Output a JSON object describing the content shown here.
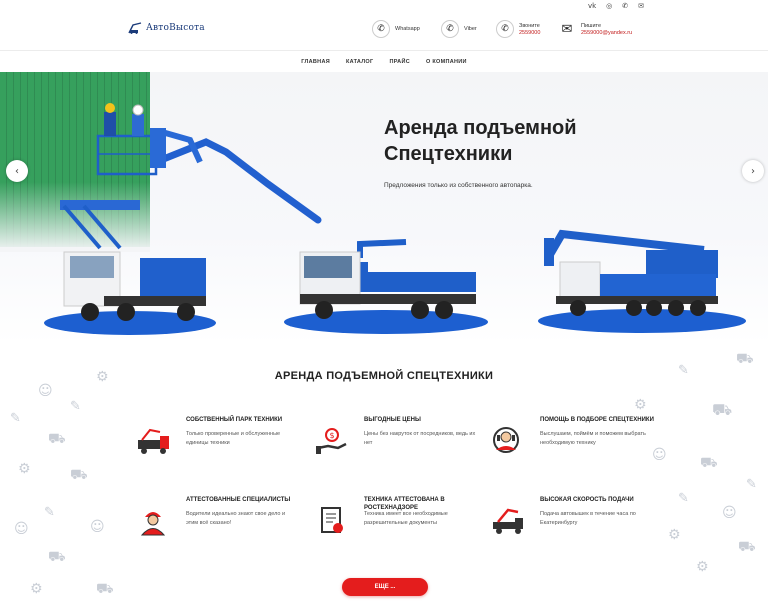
{
  "social": {
    "items": [
      {
        "icon": "vk-icon",
        "glyph": "vk"
      },
      {
        "icon": "instagram-icon",
        "glyph": "◎"
      },
      {
        "icon": "phone-icon",
        "glyph": "✆"
      },
      {
        "icon": "mail-icon",
        "glyph": "✉"
      }
    ]
  },
  "header": {
    "logo_text": "АвтоВысота",
    "contacts": [
      {
        "name": "whatsapp",
        "icon": "whatsapp-icon",
        "glyph": "✆",
        "label": "Whatsapp",
        "value": ""
      },
      {
        "name": "viber",
        "icon": "viber-icon",
        "glyph": "✆",
        "label": "Viber",
        "value": ""
      },
      {
        "name": "call",
        "icon": "phone-icon",
        "glyph": "✆",
        "label": "Звоните",
        "value": "2559000"
      },
      {
        "name": "email",
        "icon": "envelope-icon",
        "glyph": "✉",
        "label": "Пишите",
        "value": "2559000@yandex.ru"
      }
    ]
  },
  "nav": {
    "items": [
      "ГЛАВНАЯ",
      "КАТАЛОГ",
      "ПРАЙС",
      "О КОМПАНИИ"
    ]
  },
  "hero": {
    "title_line1": "Аренда подъемной",
    "title_line2": "Спецтехники",
    "subtitle": "Предложения только из собственного автопарка.",
    "prev_glyph": "‹",
    "next_glyph": "›"
  },
  "features": {
    "title": "АРЕНДА ПОДЪЕМНОЙ СПЕЦТЕХНИКИ",
    "items": [
      {
        "title": "СОБСТВЕННЫЙ ПАРК ТЕХНИКИ",
        "desc": "Только проверенные и обслуженные единицы техники",
        "icon": "truck-crane-icon"
      },
      {
        "title": "ВЫГОДНЫЕ ЦЕНЫ",
        "desc": "Цены без накруток от посредников, ведь их нет",
        "icon": "money-hand-icon"
      },
      {
        "title": "ПОМОЩЬ В ПОДБОРЕ СПЕЦТЕХНИКИ",
        "desc": "Выслушаем, поймём и поможем выбрать необходимую технику",
        "icon": "operator-icon"
      },
      {
        "title": "АТТЕСТОВАННЫЕ СПЕЦИАЛИСТЫ",
        "desc": "Водители идеально знают свое дело и этим всё сказано!",
        "icon": "worker-icon"
      },
      {
        "title": "ТЕХНИКА АТТЕСТОВАНА В РОСТЕХНАДЗОРЕ",
        "desc": "Техника имеет все необходимые разрешительные документы",
        "icon": "document-icon"
      },
      {
        "title": "ВЫСОКАЯ СКОРОСТЬ ПОДАЧИ",
        "desc": "Подача автовышек в течение часа по Екатеринбургу",
        "icon": "crane-truck-icon"
      }
    ],
    "more_label": "ЕЩЕ ..."
  },
  "colors": {
    "accent_red": "#e41d1d",
    "brand_blue": "#1b3b7a",
    "vehicle_blue": "#1f5fc9"
  }
}
